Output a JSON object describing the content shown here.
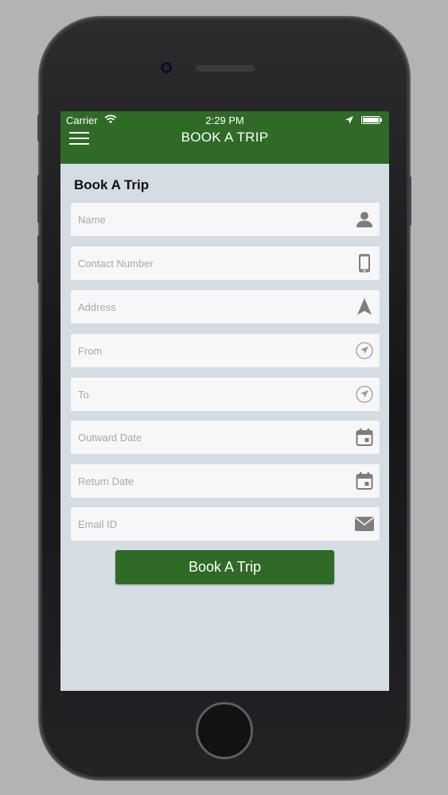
{
  "status_bar": {
    "carrier": "Carrier",
    "time": "2:29 PM"
  },
  "nav": {
    "title": "BOOK A TRIP"
  },
  "form": {
    "title": "Book A Trip",
    "fields": [
      {
        "placeholder": "Name",
        "icon": "person-icon"
      },
      {
        "placeholder": "Contact Number",
        "icon": "phone-icon"
      },
      {
        "placeholder": "Address",
        "icon": "navigation-arrow-icon"
      },
      {
        "placeholder": "From",
        "icon": "location-arrow-icon"
      },
      {
        "placeholder": "To",
        "icon": "location-arrow-icon"
      },
      {
        "placeholder": "Outward Date",
        "icon": "calendar-icon"
      },
      {
        "placeholder": "Return Date",
        "icon": "calendar-icon"
      },
      {
        "placeholder": "Email ID",
        "icon": "envelope-icon"
      }
    ],
    "submit_label": "Book A Trip"
  },
  "colors": {
    "brand_green": "#2f6a27",
    "screen_background": "#d3dde3",
    "field_background": "#f7f7f7"
  }
}
